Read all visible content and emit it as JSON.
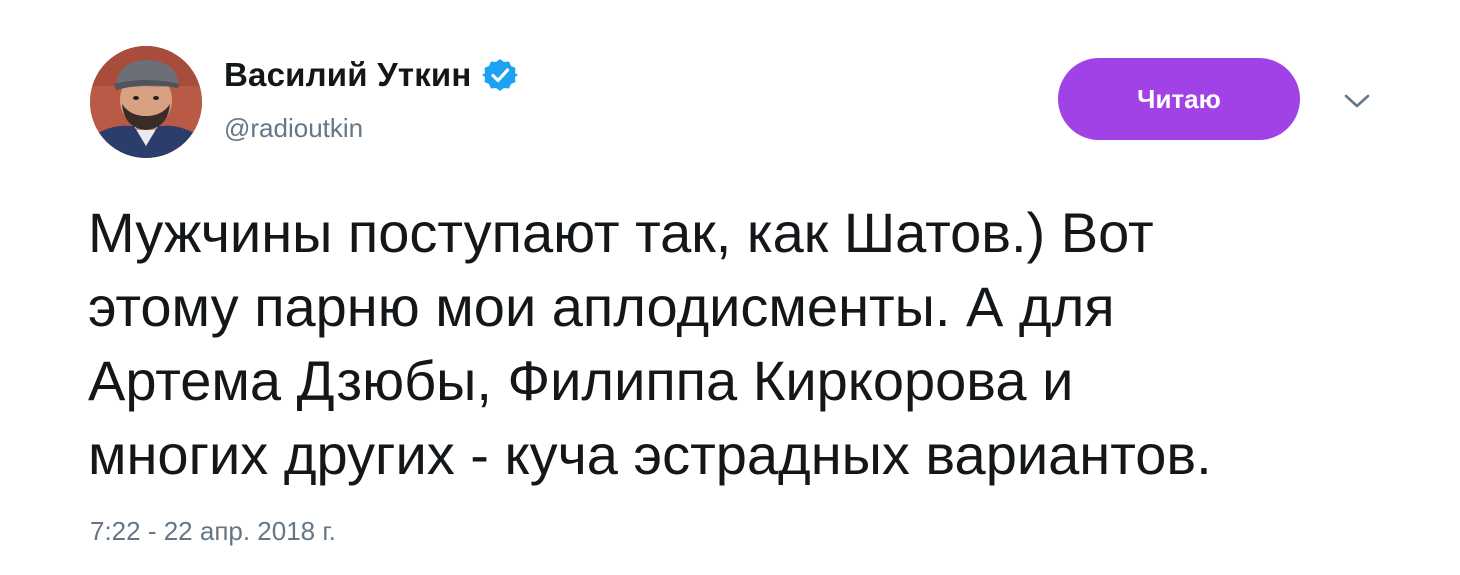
{
  "author": {
    "display_name": "Василий Уткин",
    "handle": "@radioutkin",
    "verified": true,
    "avatar_icon": "user-avatar-photo"
  },
  "follow_button": {
    "label": "Читаю",
    "color": "#a142e6"
  },
  "menu_icon": "chevron-down-icon",
  "tweet": {
    "lines": [
      "Мужчины поступают так, как Шатов.) Вот",
      "этому парню мои аплодисменты. А для",
      "Артема Дзюбы, Филиппа Киркорова и",
      "многих других - куча эстрадных вариантов."
    ],
    "timestamp": "7:22 - 22 апр. 2018 г."
  },
  "colors": {
    "verified_badge": "#1da1f2",
    "secondary_text": "#657786"
  }
}
